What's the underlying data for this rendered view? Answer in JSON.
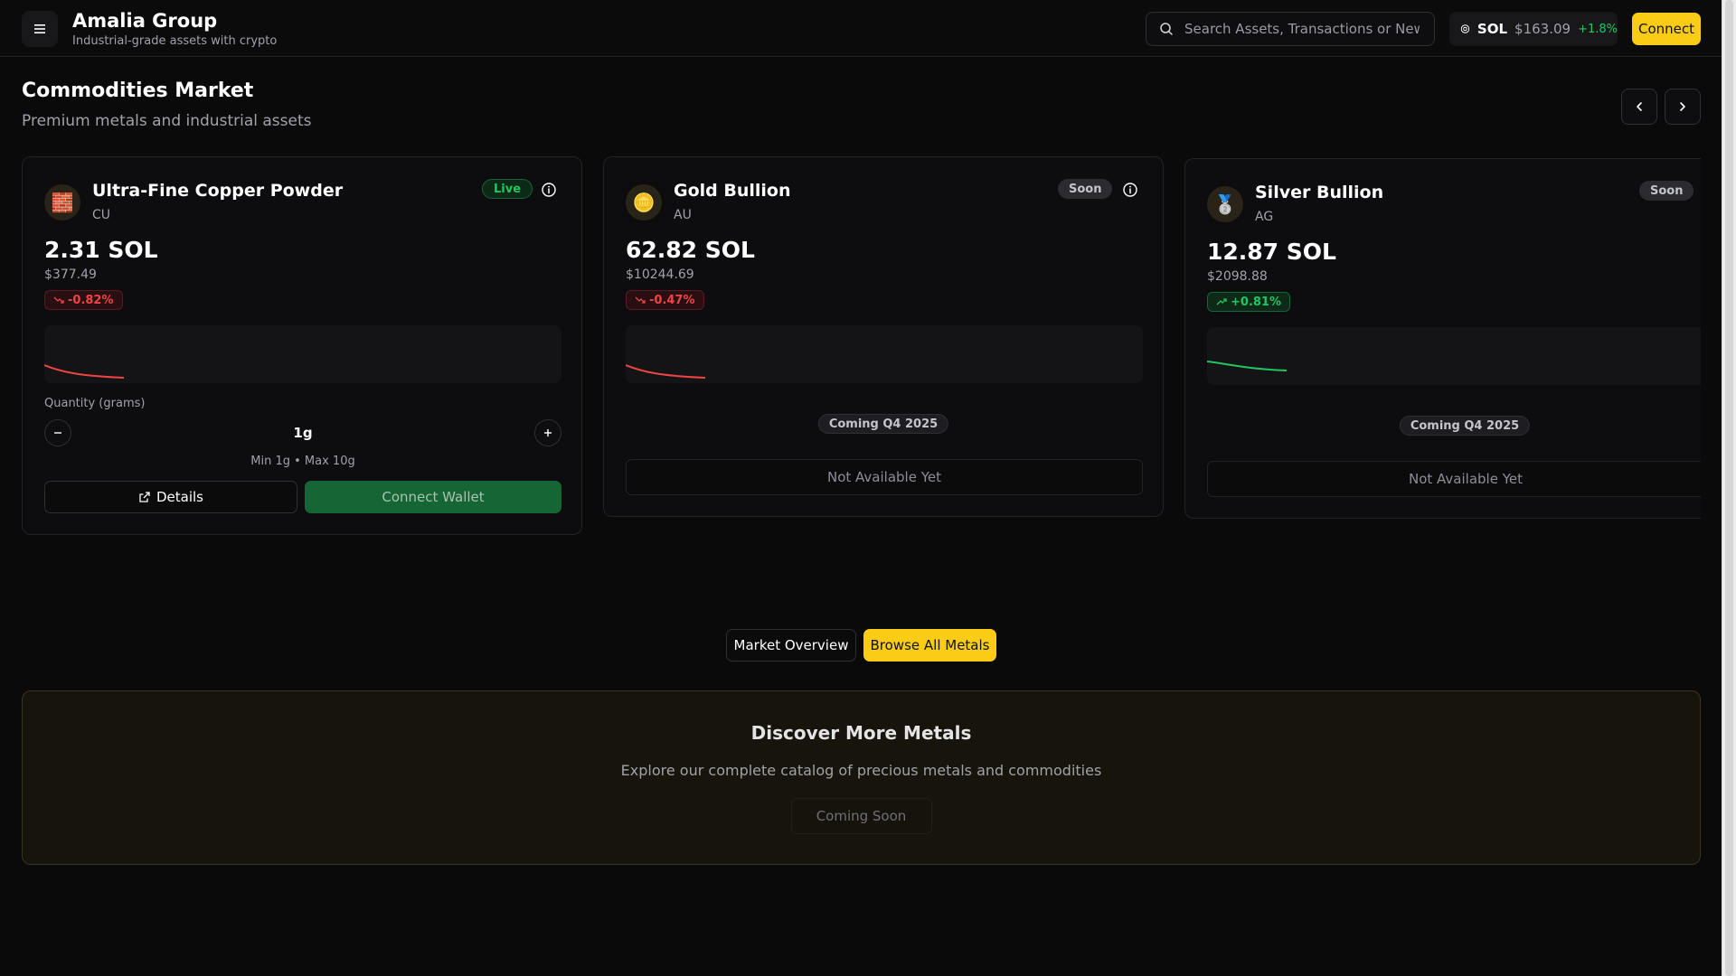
{
  "header": {
    "title": "Amalia Group",
    "subtitle": "Industrial-grade assets with crypto",
    "search_placeholder": "Search Assets, Transactions or News",
    "sol": {
      "symbol": "SOL",
      "price": "$163.09",
      "change": "+1.8%"
    },
    "connect_label": "Connect"
  },
  "section": {
    "title": "Commodities Market",
    "subtitle": "Premium metals and industrial assets"
  },
  "cards": [
    {
      "icon": "brick-icon",
      "icon_glyph": "🧱",
      "name": "Ultra-Fine Copper Powder",
      "code": "CU",
      "status": "Live",
      "price_sol": "2.31 SOL",
      "price_usd": "$377.49",
      "change": "-0.82%",
      "trend": "down",
      "quantity_label": "Quantity (grams)",
      "quantity": "1g",
      "range": "Min 1g • Max 10g",
      "details_label": "Details",
      "wallet_label": "Connect Wallet"
    },
    {
      "icon": "gold-coin-icon",
      "icon_glyph": "🪙",
      "name": "Gold Bullion",
      "code": "AU",
      "status": "Soon",
      "price_sol": "62.82 SOL",
      "price_usd": "$10244.69",
      "change": "-0.47%",
      "trend": "down",
      "coming": "Coming Q4 2025",
      "unavailable_label": "Not Available Yet"
    },
    {
      "icon": "silver-medal-icon",
      "icon_glyph": "🥈",
      "name": "Silver Bullion",
      "code": "AG",
      "status": "Soon",
      "price_sol": "12.87 SOL",
      "price_usd": "$2098.88",
      "change": "+0.81%",
      "trend": "up",
      "coming": "Coming Q4 2025",
      "unavailable_label": "Not Available Yet"
    }
  ],
  "actions": {
    "overview_label": "Market Overview",
    "browse_label": "Browse All Metals"
  },
  "discover": {
    "title": "Discover More Metals",
    "subtitle": "Explore our complete catalog of precious metals and commodities",
    "button_label": "Coming Soon"
  },
  "colors": {
    "accent": "#facc15",
    "positive": "#22c55e",
    "negative": "#ef4444",
    "background": "#0a0a0b"
  }
}
